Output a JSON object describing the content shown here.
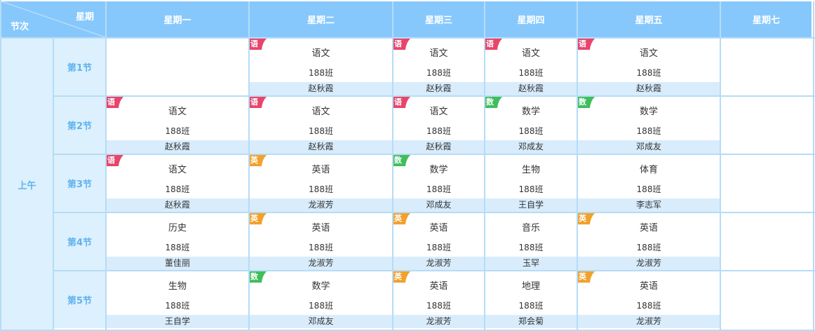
{
  "header": {
    "corner_weekday": "星期",
    "corner_period": "节次",
    "days": [
      "星期一",
      "星期二",
      "星期三",
      "星期四",
      "星期五",
      "星期七"
    ]
  },
  "section": "上午",
  "periods": [
    "第1节",
    "第2节",
    "第3节",
    "第4节",
    "第5节"
  ],
  "tags": {
    "语": {
      "label": "语",
      "color": "#e8456b"
    },
    "数": {
      "label": "数",
      "color": "#3fbe5c"
    },
    "英": {
      "label": "英",
      "color": "#f2a12b"
    }
  },
  "schedule": [
    [
      null,
      {
        "subject": "语文",
        "class": "188班",
        "teacher": "赵秋霞",
        "tag": "语"
      },
      {
        "subject": "语文",
        "class": "188班",
        "teacher": "赵秋霞",
        "tag": "语"
      },
      {
        "subject": "语文",
        "class": "188班",
        "teacher": "赵秋霞",
        "tag": "语"
      },
      {
        "subject": "语文",
        "class": "188班",
        "teacher": "赵秋霞",
        "tag": "语"
      },
      null
    ],
    [
      {
        "subject": "语文",
        "class": "188班",
        "teacher": "赵秋霞",
        "tag": "语"
      },
      {
        "subject": "语文",
        "class": "188班",
        "teacher": "赵秋霞",
        "tag": "语"
      },
      {
        "subject": "语文",
        "class": "188班",
        "teacher": "赵秋霞",
        "tag": "语"
      },
      {
        "subject": "数学",
        "class": "188班",
        "teacher": "邓成友",
        "tag": "数"
      },
      {
        "subject": "数学",
        "class": "188班",
        "teacher": "邓成友",
        "tag": "数"
      },
      null
    ],
    [
      {
        "subject": "语文",
        "class": "188班",
        "teacher": "赵秋霞",
        "tag": "语"
      },
      {
        "subject": "英语",
        "class": "188班",
        "teacher": "龙淑芳",
        "tag": "英"
      },
      {
        "subject": "数学",
        "class": "188班",
        "teacher": "邓成友",
        "tag": "数"
      },
      {
        "subject": "生物",
        "class": "188班",
        "teacher": "王自学",
        "tag": null
      },
      {
        "subject": "体育",
        "class": "188班",
        "teacher": "李志军",
        "tag": null
      },
      null
    ],
    [
      {
        "subject": "历史",
        "class": "188班",
        "teacher": "董佳丽",
        "tag": null
      },
      {
        "subject": "英语",
        "class": "188班",
        "teacher": "龙淑芳",
        "tag": "英"
      },
      {
        "subject": "英语",
        "class": "188班",
        "teacher": "龙淑芳",
        "tag": "英"
      },
      {
        "subject": "音乐",
        "class": "188班",
        "teacher": "玉罕",
        "tag": null
      },
      {
        "subject": "英语",
        "class": "188班",
        "teacher": "龙淑芳",
        "tag": "英"
      },
      null
    ],
    [
      {
        "subject": "生物",
        "class": "188班",
        "teacher": "王自学",
        "tag": null
      },
      {
        "subject": "数学",
        "class": "188班",
        "teacher": "邓成友",
        "tag": "数"
      },
      {
        "subject": "英语",
        "class": "188班",
        "teacher": "龙淑芳",
        "tag": "英"
      },
      {
        "subject": "地理",
        "class": "188班",
        "teacher": "郑会菊",
        "tag": null
      },
      {
        "subject": "英语",
        "class": "188班",
        "teacher": "龙淑芳",
        "tag": "英"
      },
      null
    ]
  ]
}
